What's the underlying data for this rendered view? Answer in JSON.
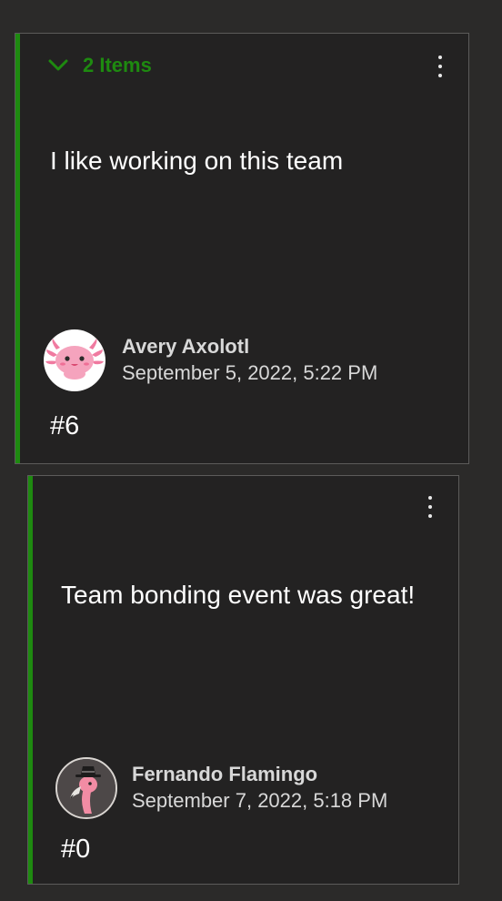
{
  "accent_color": "#1e8a10",
  "cards": [
    {
      "group_label": "2 Items",
      "group_toggle_icon": "chevron-down-icon",
      "more_icon": "vertical-ellipsis-icon",
      "message": "I like working on this team",
      "author": {
        "name": "Avery Axolotl",
        "date": "September 5, 2022, 5:22 PM",
        "avatar_icon": "axolotl-avatar"
      },
      "vote_count": "#6"
    },
    {
      "more_icon": "vertical-ellipsis-icon",
      "message": "Team bonding event was great!",
      "author": {
        "name": "Fernando Flamingo",
        "date": "September 7, 2022, 5:18 PM",
        "avatar_icon": "flamingo-avatar"
      },
      "vote_count": "#0"
    }
  ]
}
